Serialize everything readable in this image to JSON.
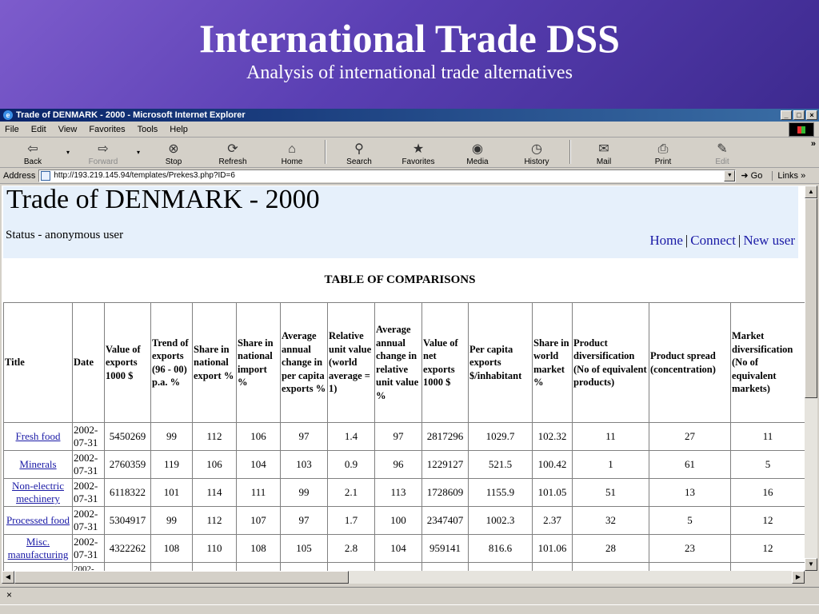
{
  "slide": {
    "title": "International Trade DSS",
    "subtitle": "Analysis of international trade alternatives"
  },
  "window": {
    "title": "Trade of DENMARK - 2000 - Microsoft Internet Explorer",
    "minimize": "_",
    "maximize": "□",
    "close": "×"
  },
  "menu": [
    "File",
    "Edit",
    "View",
    "Favorites",
    "Tools",
    "Help"
  ],
  "toolbar": {
    "back": "Back",
    "forward": "Forward",
    "stop": "Stop",
    "refresh": "Refresh",
    "home": "Home",
    "search": "Search",
    "favorites": "Favorites",
    "media": "Media",
    "history": "History",
    "mail": "Mail",
    "print": "Print",
    "edit": "Edit"
  },
  "address": {
    "label": "Address",
    "url": "http://193.219.145.94/templates/Prekes3.php?ID=6",
    "go": "Go",
    "links": "Links"
  },
  "page": {
    "heading": "Trade of DENMARK - 2000",
    "status": "Status - anonymous user",
    "nav": {
      "home": "Home",
      "connect": "Connect",
      "new_user": "New user"
    },
    "table_caption": "TABLE OF COMPARISONS"
  },
  "table": {
    "headers": [
      "Title",
      "Date",
      "Value of exports 1000 $",
      "Trend of exports (96 - 00) p.a. %",
      "Share in national export %",
      "Share in national import %",
      "Average annual change in per capita exports %",
      "Relative unit value (world average = 1)",
      "Average annual change in relative unit value %",
      "Value of net exports 1000 $",
      "Per capita exports $/inhabitant",
      "Share in world market %",
      "Product diversification (No of equivalent products)",
      "Product spread (concentration)",
      "Market diversification (No of equivalent markets)"
    ],
    "rows": [
      [
        "Fresh food",
        "2002-07-31",
        "5450269",
        "99",
        "112",
        "106",
        "97",
        "1.4",
        "97",
        "2817296",
        "1029.7",
        "102.32",
        "11",
        "27",
        "11"
      ],
      [
        "Minerals",
        "2002-07-31",
        "2760359",
        "119",
        "106",
        "104",
        "103",
        "0.9",
        "96",
        "1229127",
        "521.5",
        "100.42",
        "1",
        "61",
        "5"
      ],
      [
        "Non-electric mechinery",
        "2002-07-31",
        "6118322",
        "101",
        "114",
        "111",
        "99",
        "2.1",
        "113",
        "1728609",
        "1155.9",
        "101.05",
        "51",
        "13",
        "16"
      ],
      [
        "Processed food",
        "2002-07-31",
        "5304917",
        "99",
        "112",
        "107",
        "97",
        "1.7",
        "100",
        "2347407",
        "1002.3",
        "2.37",
        "32",
        "5",
        "12"
      ],
      [
        "Misc. manufacturing",
        "2002-07-31",
        "4322262",
        "108",
        "110",
        "108",
        "105",
        "2.8",
        "104",
        "959141",
        "816.6",
        "101.06",
        "28",
        "23",
        "12"
      ]
    ],
    "partial_date": "2002-"
  },
  "findbar_close": "×"
}
